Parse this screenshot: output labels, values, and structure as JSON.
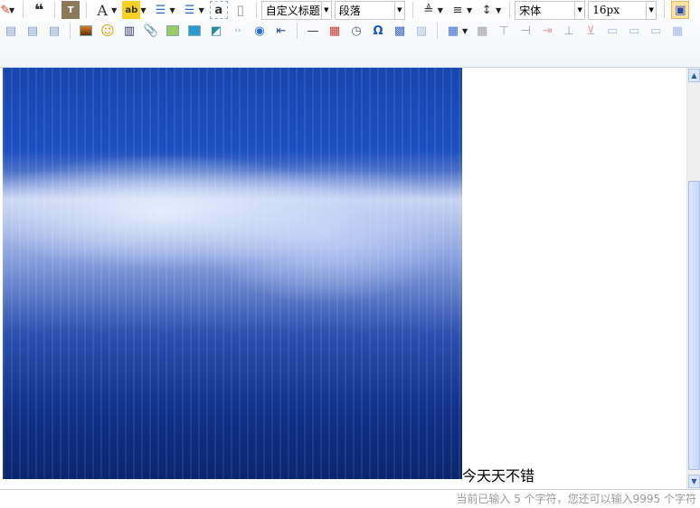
{
  "toolbar": {
    "heading_select": "自定义标题",
    "paragraph_select": "段落",
    "font_family_select": "宋体",
    "font_size_select": "16px",
    "row1_icons": [
      "format-brush-icon",
      "blockquote-icon",
      "paste-plain-icon",
      "font-color-icon",
      "highlight-icon",
      "ordered-list-icon",
      "unordered-list-icon",
      "select-all-icon",
      "clear-doc-icon"
    ],
    "row2_icons": [
      "align-left-icon",
      "align-center-icon",
      "align-right-icon",
      "image-icon",
      "emoticon-icon",
      "video-icon",
      "attachment-icon",
      "map-icon",
      "gmap-icon",
      "iframe-icon",
      "code-icon",
      "spechars-icon",
      "pagebreak-icon",
      "horizontal-line-icon",
      "date-icon",
      "time-icon",
      "omega-icon",
      "link-icon",
      "word-image-icon",
      "table-icon"
    ]
  },
  "editor": {
    "content_text": "今天天不错"
  },
  "status": {
    "word_count": "当前已输入 5 个字符，您还可以输入9995 个字符"
  },
  "colors": {
    "accent": "#c5d5ea",
    "status_text": "#999999"
  }
}
